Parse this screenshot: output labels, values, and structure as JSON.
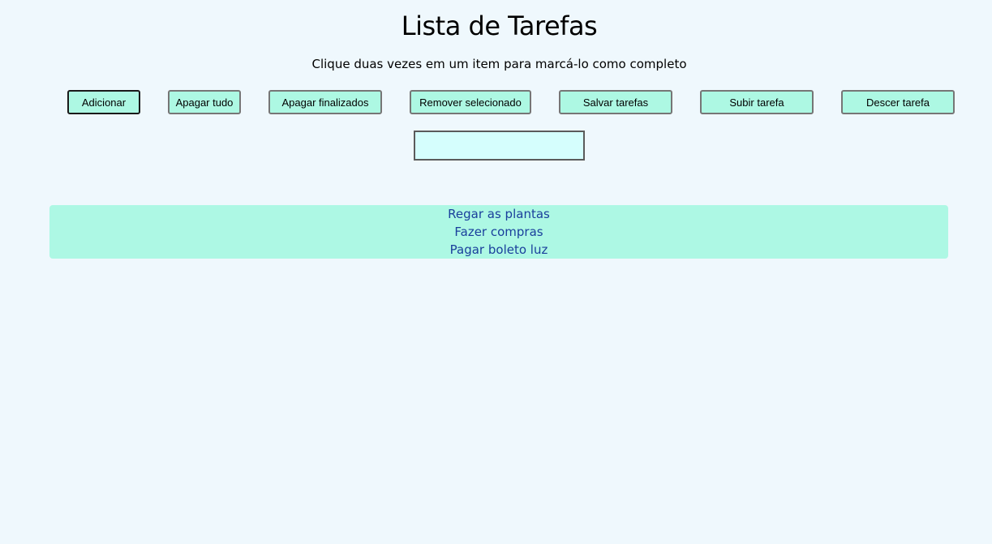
{
  "header": {
    "title": "Lista de Tarefas",
    "subtitle": "Clique duas vezes em um item para marcá-lo como completo"
  },
  "toolbar": {
    "add_label": "Adicionar",
    "clear_all_label": "Apagar tudo",
    "clear_done_label": "Apagar finalizados",
    "remove_selected_label": "Remover selecionado",
    "save_label": "Salvar tarefas",
    "move_up_label": "Subir tarefa",
    "move_down_label": "Descer tarefa"
  },
  "input": {
    "value": "",
    "placeholder": ""
  },
  "tasks": [
    {
      "label": "Regar as plantas"
    },
    {
      "label": "Fazer compras"
    },
    {
      "label": "Pagar boleto luz"
    }
  ],
  "colors": {
    "background": "#eff8fd",
    "button_bg": "#adf8e3",
    "input_bg": "#d5fefd",
    "list_bg": "#adf8e4",
    "task_text": "#1a3f9c"
  }
}
